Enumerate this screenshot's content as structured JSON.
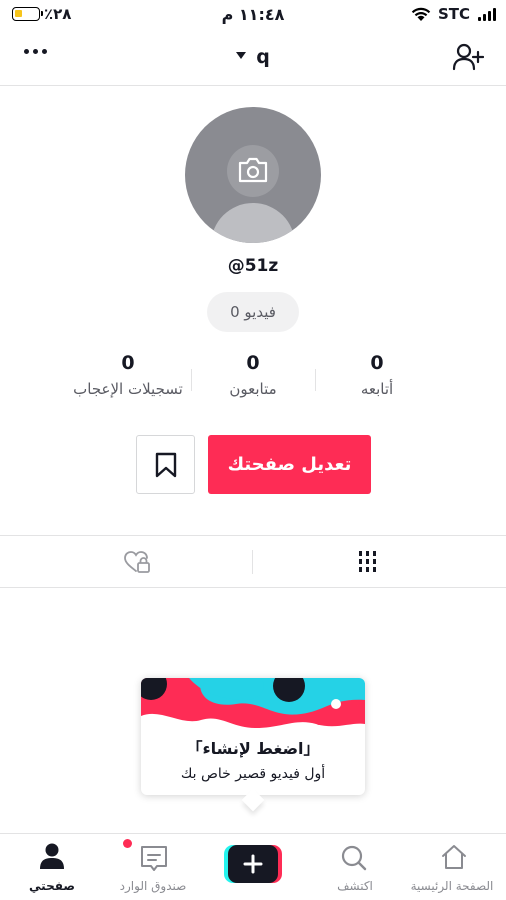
{
  "status_bar": {
    "battery_percent": "٪٢٨",
    "time": "١١:٤٨ م",
    "carrier": "STC"
  },
  "header": {
    "username": "q",
    "icons": [
      "more-icon",
      "caret-down-icon",
      "add-user-icon"
    ]
  },
  "profile": {
    "handle": "@51z",
    "video_count": "0 فيديو"
  },
  "stats": {
    "following": {
      "value": "0",
      "label": "أتابعه"
    },
    "followers": {
      "value": "0",
      "label": "متابعون"
    },
    "likes": {
      "value": "0",
      "label": "تسجيلات الإعجاب"
    }
  },
  "actions": {
    "edit_profile_label": "تعديل صفحتك"
  },
  "tabs": {
    "items": [
      "videos-grid-icon",
      "liked-private-icon"
    ],
    "selected": "videos"
  },
  "create_popup": {
    "title": "اضغط لإنشاء",
    "subtitle": "أول فيديو قصير خاص بك"
  },
  "bottom_nav": {
    "home_label": "الصفحة الرئيسية",
    "discover_label": "اكتشف",
    "inbox_label": "صندوق الوارد",
    "me_label": "صفحتي",
    "active": "me"
  },
  "colors": {
    "accent": "#fe2c55",
    "cyan": "#25f4ee",
    "text": "#161823",
    "muted": "#8a8b91"
  }
}
